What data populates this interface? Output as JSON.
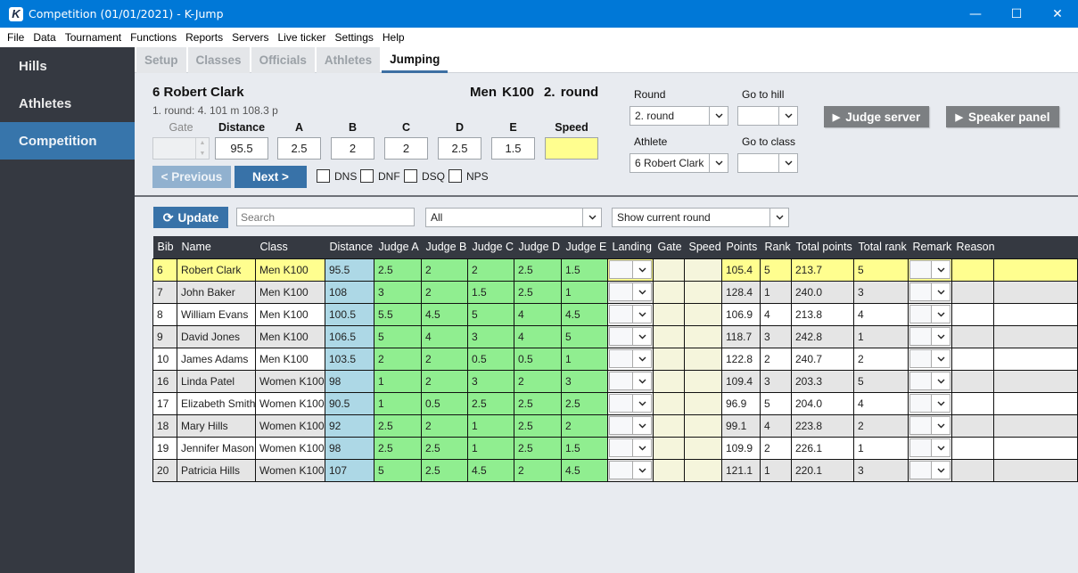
{
  "window": {
    "title": "Competition (01/01/2021) - K-Jump",
    "app_icon_letter": "K",
    "controls": {
      "minimize": "—",
      "maximize": "☐",
      "close": "✕"
    }
  },
  "menu": [
    "File",
    "Data",
    "Tournament",
    "Functions",
    "Reports",
    "Servers",
    "Live ticker",
    "Settings",
    "Help"
  ],
  "sidebar": {
    "items": [
      {
        "label": "Hills",
        "active": false
      },
      {
        "label": "Athletes",
        "active": false
      },
      {
        "label": "Competition",
        "active": true
      }
    ]
  },
  "tabs": [
    {
      "label": "Setup",
      "active": false
    },
    {
      "label": "Classes",
      "active": false
    },
    {
      "label": "Officials",
      "active": false
    },
    {
      "label": "Athletes",
      "active": false
    },
    {
      "label": "Jumping",
      "active": true
    }
  ],
  "current": {
    "athlete": "6 Robert Clark",
    "previous_round": "1. round:  4. 101 m  108.3 p",
    "class": "Men K100",
    "round": "2. round"
  },
  "fields": {
    "gate": {
      "label": "Gate",
      "value": ""
    },
    "distance": {
      "label": "Distance",
      "value": "95.5"
    },
    "a": {
      "label": "A",
      "value": "2.5"
    },
    "b": {
      "label": "B",
      "value": "2"
    },
    "c": {
      "label": "C",
      "value": "2"
    },
    "d": {
      "label": "D",
      "value": "2.5"
    },
    "e": {
      "label": "E",
      "value": "1.5"
    },
    "speed": {
      "label": "Speed",
      "value": ""
    }
  },
  "nav": {
    "previous": "< Previous",
    "next": "Next >"
  },
  "flags": [
    {
      "label": "DNS",
      "checked": false
    },
    {
      "label": "DNF",
      "checked": false
    },
    {
      "label": "DSQ",
      "checked": false
    },
    {
      "label": "NPS",
      "checked": false
    }
  ],
  "selectors": {
    "round": {
      "label": "Round",
      "value": "2. round"
    },
    "go_to_hill": {
      "label": "Go to hill",
      "value": ""
    },
    "athlete": {
      "label": "Athlete",
      "value": "6 Robert Clark"
    },
    "go_to_class": {
      "label": "Go to class",
      "value": ""
    }
  },
  "actions": {
    "judge_server": "Judge server",
    "speaker_panel": "Speaker panel"
  },
  "toolbar": {
    "update": "Update",
    "search_placeholder": "Search",
    "filter": "All",
    "round_filter": "Show current round"
  },
  "colors": {
    "accent": "#3872a8",
    "current_row": "#fffe8f",
    "distance_cell": "#add8e6",
    "judge_cell": "#90ee90",
    "gate_speed_cell": "#f5f5dc"
  },
  "table": {
    "columns": [
      "Bib",
      "Name",
      "Class",
      "Distance",
      "Judge A",
      "Judge B",
      "Judge C",
      "Judge D",
      "Judge E",
      "Landing",
      "Gate",
      "Speed",
      "Points",
      "Rank",
      "Total points",
      "Total rank",
      "Remark",
      "Reason"
    ],
    "rows": [
      {
        "bib": "6",
        "name": "Robert Clark",
        "class": "Men K100",
        "distance": "95.5",
        "a": "2.5",
        "b": "2",
        "c": "2",
        "d": "2.5",
        "e": "1.5",
        "landing": "",
        "gate": "",
        "speed": "",
        "points": "105.4",
        "rank": "5",
        "total_points": "213.7",
        "total_rank": "5",
        "remark": "",
        "reason": "",
        "current": true
      },
      {
        "bib": "7",
        "name": "John Baker",
        "class": "Men K100",
        "distance": "108",
        "a": "3",
        "b": "2",
        "c": "1.5",
        "d": "2.5",
        "e": "1",
        "landing": "",
        "gate": "",
        "speed": "",
        "points": "128.4",
        "rank": "1",
        "total_points": "240.0",
        "total_rank": "3",
        "remark": "",
        "reason": ""
      },
      {
        "bib": "8",
        "name": "William Evans",
        "class": "Men K100",
        "distance": "100.5",
        "a": "5.5",
        "b": "4.5",
        "c": "5",
        "d": "4",
        "e": "4.5",
        "landing": "",
        "gate": "",
        "speed": "",
        "points": "106.9",
        "rank": "4",
        "total_points": "213.8",
        "total_rank": "4",
        "remark": "",
        "reason": ""
      },
      {
        "bib": "9",
        "name": "David Jones",
        "class": "Men K100",
        "distance": "106.5",
        "a": "5",
        "b": "4",
        "c": "3",
        "d": "4",
        "e": "5",
        "landing": "",
        "gate": "",
        "speed": "",
        "points": "118.7",
        "rank": "3",
        "total_points": "242.8",
        "total_rank": "1",
        "remark": "",
        "reason": ""
      },
      {
        "bib": "10",
        "name": "James Adams",
        "class": "Men K100",
        "distance": "103.5",
        "a": "2",
        "b": "2",
        "c": "0.5",
        "d": "0.5",
        "e": "1",
        "landing": "",
        "gate": "",
        "speed": "",
        "points": "122.8",
        "rank": "2",
        "total_points": "240.7",
        "total_rank": "2",
        "remark": "",
        "reason": ""
      },
      {
        "bib": "16",
        "name": "Linda Patel",
        "class": "Women K100",
        "distance": "98",
        "a": "1",
        "b": "2",
        "c": "3",
        "d": "2",
        "e": "3",
        "landing": "",
        "gate": "",
        "speed": "",
        "points": "109.4",
        "rank": "3",
        "total_points": "203.3",
        "total_rank": "5",
        "remark": "",
        "reason": ""
      },
      {
        "bib": "17",
        "name": "Elizabeth Smith",
        "class": "Women K100",
        "distance": "90.5",
        "a": "1",
        "b": "0.5",
        "c": "2.5",
        "d": "2.5",
        "e": "2.5",
        "landing": "",
        "gate": "",
        "speed": "",
        "points": "96.9",
        "rank": "5",
        "total_points": "204.0",
        "total_rank": "4",
        "remark": "",
        "reason": ""
      },
      {
        "bib": "18",
        "name": "Mary Hills",
        "class": "Women K100",
        "distance": "92",
        "a": "2.5",
        "b": "2",
        "c": "1",
        "d": "2.5",
        "e": "2",
        "landing": "",
        "gate": "",
        "speed": "",
        "points": "99.1",
        "rank": "4",
        "total_points": "223.8",
        "total_rank": "2",
        "remark": "",
        "reason": ""
      },
      {
        "bib": "19",
        "name": "Jennifer Mason",
        "class": "Women K100",
        "distance": "98",
        "a": "2.5",
        "b": "2.5",
        "c": "1",
        "d": "2.5",
        "e": "1.5",
        "landing": "",
        "gate": "",
        "speed": "",
        "points": "109.9",
        "rank": "2",
        "total_points": "226.1",
        "total_rank": "1",
        "remark": "",
        "reason": ""
      },
      {
        "bib": "20",
        "name": "Patricia Hills",
        "class": "Women K100",
        "distance": "107",
        "a": "5",
        "b": "2.5",
        "c": "4.5",
        "d": "2",
        "e": "4.5",
        "landing": "",
        "gate": "",
        "speed": "",
        "points": "121.1",
        "rank": "1",
        "total_points": "220.1",
        "total_rank": "3",
        "remark": "",
        "reason": ""
      }
    ]
  }
}
